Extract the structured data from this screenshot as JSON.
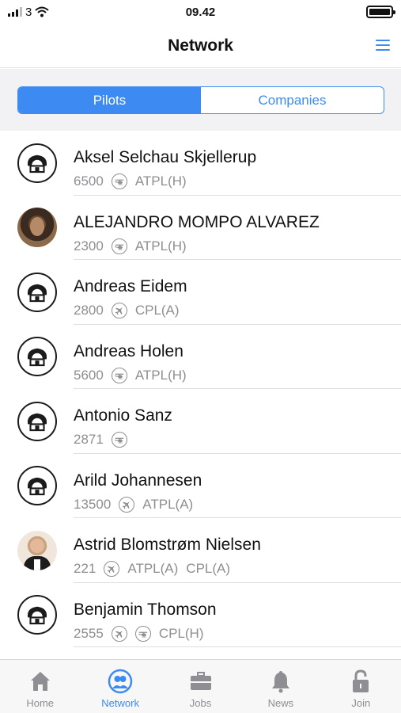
{
  "status_bar": {
    "carrier": "3",
    "time": "09.42"
  },
  "header": {
    "title": "Network"
  },
  "segments": [
    {
      "label": "Pilots",
      "active": true
    },
    {
      "label": "Companies",
      "active": false
    }
  ],
  "pilots": [
    {
      "name": "Aksel Selchau Skjellerup",
      "hours": "6500",
      "aircraft_icons": [
        "helicopter-icon"
      ],
      "licenses": [
        "ATPL(H)"
      ],
      "avatar": "logo"
    },
    {
      "name": "ALEJANDRO MOMPO ALVAREZ",
      "hours": "2300",
      "aircraft_icons": [
        "helicopter-icon"
      ],
      "licenses": [
        "ATPL(H)"
      ],
      "avatar": "photo"
    },
    {
      "name": "Andreas Eidem",
      "hours": "2800",
      "aircraft_icons": [
        "airplane-icon"
      ],
      "licenses": [
        "CPL(A)"
      ],
      "avatar": "logo"
    },
    {
      "name": "Andreas Holen",
      "hours": "5600",
      "aircraft_icons": [
        "helicopter-icon"
      ],
      "licenses": [
        "ATPL(H)"
      ],
      "avatar": "logo"
    },
    {
      "name": "Antonio Sanz",
      "hours": "2871",
      "aircraft_icons": [
        "helicopter-icon"
      ],
      "licenses": [],
      "avatar": "logo"
    },
    {
      "name": "Arild Johannesen",
      "hours": "13500",
      "aircraft_icons": [
        "airplane-icon"
      ],
      "licenses": [
        "ATPL(A)"
      ],
      "avatar": "logo"
    },
    {
      "name": "Astrid Blomstrøm Nielsen",
      "hours": "221",
      "aircraft_icons": [
        "airplane-icon"
      ],
      "licenses": [
        "ATPL(A)",
        "CPL(A)"
      ],
      "avatar": "photo"
    },
    {
      "name": "Benjamin Thomson",
      "hours": "2555",
      "aircraft_icons": [
        "airplane-icon",
        "helicopter-icon"
      ],
      "licenses": [
        "CPL(H)"
      ],
      "avatar": "logo"
    }
  ],
  "tabs": [
    {
      "label": "Home",
      "icon": "home-icon",
      "active": false
    },
    {
      "label": "Network",
      "icon": "network-icon",
      "active": true
    },
    {
      "label": "Jobs",
      "icon": "briefcase-icon",
      "active": false
    },
    {
      "label": "News",
      "icon": "bell-icon",
      "active": false
    },
    {
      "label": "Join",
      "icon": "lock-icon",
      "active": false
    }
  ],
  "colors": {
    "accent": "#3d8bf2",
    "muted": "#8e8e93",
    "segment_bg": "#f2f2f4"
  }
}
